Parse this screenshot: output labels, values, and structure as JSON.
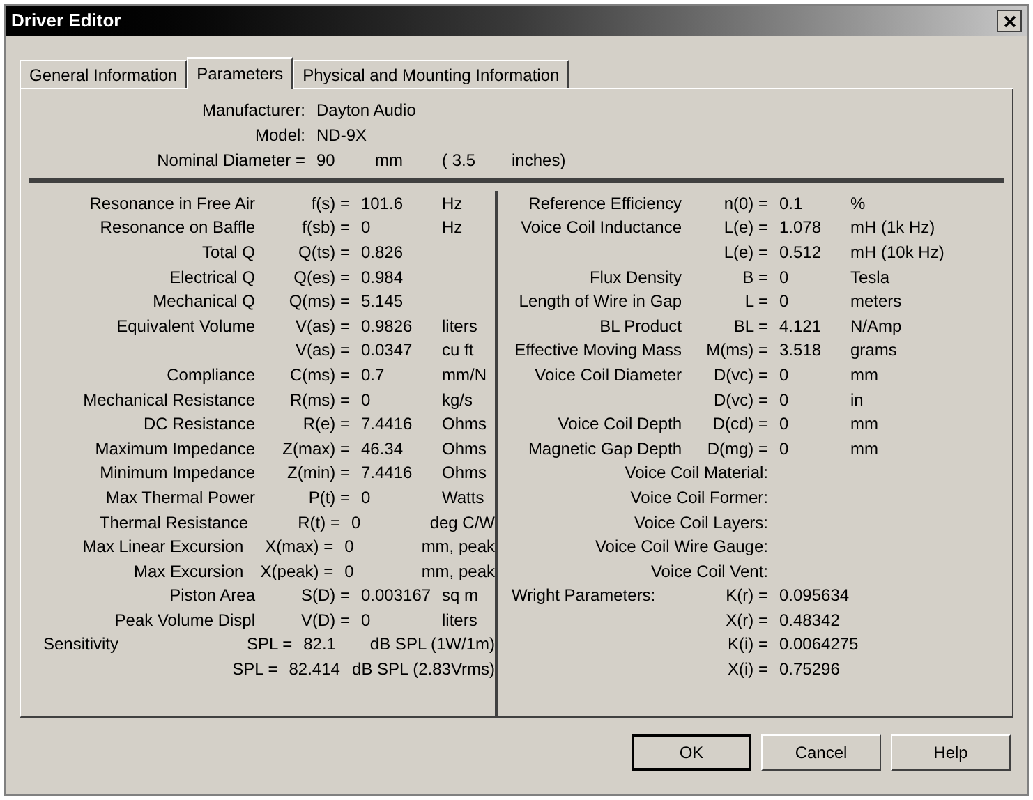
{
  "window": {
    "title": "Driver Editor"
  },
  "tabs": [
    {
      "label": "General Information",
      "selected": false
    },
    {
      "label": "Parameters",
      "selected": true
    },
    {
      "label": "Physical and Mounting Information",
      "selected": false
    }
  ],
  "header": [
    {
      "label": "Manufacturer:",
      "value": "Dayton Audio"
    },
    {
      "label": "Model:",
      "value": "ND-9X"
    }
  ],
  "nominal_diameter": {
    "label": "Nominal Diameter =",
    "value": "90",
    "unit": "mm",
    "alt_value": "( 3.5",
    "alt_unit": "inches)"
  },
  "left_params": [
    {
      "kind": "param",
      "label": "Resonance in Free Air",
      "symbol": "f(s) =",
      "value": "101.6",
      "unit": "Hz"
    },
    {
      "kind": "param",
      "label": "Resonance on Baffle",
      "symbol": "f(sb) =",
      "value": "0",
      "unit": "Hz"
    },
    {
      "kind": "param",
      "label": "Total Q",
      "symbol": "Q(ts) =",
      "value": "0.826"
    },
    {
      "kind": "param",
      "label": "Electrical Q",
      "symbol": "Q(es) =",
      "value": "0.984"
    },
    {
      "kind": "param",
      "label": "Mechanical Q",
      "symbol": "Q(ms) =",
      "value": "5.145"
    },
    {
      "kind": "param",
      "label": "Equivalent Volume",
      "symbol": "V(as) =",
      "value": "0.9826",
      "unit": "liters"
    },
    {
      "kind": "param",
      "symbol": "V(as) =",
      "value": "0.0347",
      "unit": "cu ft"
    },
    {
      "kind": "param",
      "label": "Compliance",
      "symbol": "C(ms) =",
      "value": "0.7",
      "unit": "mm/N"
    },
    {
      "kind": "param",
      "label": "Mechanical Resistance",
      "symbol": "R(ms) =",
      "value": "0",
      "unit": "kg/s"
    },
    {
      "kind": "param",
      "label": "DC Resistance",
      "symbol": "R(e) =",
      "value": "7.4416",
      "unit": "Ohms"
    },
    {
      "kind": "param",
      "label": "Maximum Impedance",
      "symbol": "Z(max) =",
      "value": "46.34",
      "unit": "Ohms"
    },
    {
      "kind": "param",
      "label": "Minimum Impedance",
      "symbol": "Z(min) =",
      "value": "7.4416",
      "unit": "Ohms"
    },
    {
      "kind": "param",
      "label": "Max Thermal Power",
      "symbol": "P(t) =",
      "value": "0",
      "unit": "Watts"
    },
    {
      "kind": "param",
      "label": "Thermal Resistance",
      "symbol": "R(t) =",
      "value": "0",
      "unit": "deg C/W"
    },
    {
      "kind": "param",
      "label": "Max Linear Excursion",
      "symbol": "X(max) =",
      "value": "0",
      "unit": "mm, peak"
    },
    {
      "kind": "param",
      "label": "Max Excursion",
      "symbol": "X(peak) =",
      "value": "0",
      "unit": "mm, peak"
    },
    {
      "kind": "param",
      "label": "Piston Area",
      "symbol": "S(D) =",
      "value": "0.003167",
      "unit": "sq m"
    },
    {
      "kind": "param",
      "label": "Peak Volume Displ",
      "symbol": "V(D) =",
      "value": "0",
      "unit": "liters"
    },
    {
      "kind": "group",
      "label": "Sensitivity",
      "symbol": "SPL =",
      "value": "82.1",
      "unit": "dB SPL (1W/1m)"
    },
    {
      "kind": "group",
      "symbol": "SPL =",
      "value": "82.414",
      "unit": "dB SPL (2.83Vrms)"
    }
  ],
  "right_params": [
    {
      "kind": "param",
      "label": "Reference Efficiency",
      "symbol": "n(0) =",
      "value": "0.1",
      "unit": "%"
    },
    {
      "kind": "param",
      "label": "Voice Coil Inductance",
      "symbol": "L(e) =",
      "value": "1.078",
      "unit": "mH (1k Hz)"
    },
    {
      "kind": "param",
      "symbol": "L(e) =",
      "value": "0.512",
      "unit": "mH (10k Hz)"
    },
    {
      "kind": "param",
      "label": "Flux Density",
      "symbol": "B =",
      "value": "0",
      "unit": "Tesla"
    },
    {
      "kind": "param",
      "label": "Length of Wire in Gap",
      "symbol": "L =",
      "value": "0",
      "unit": "meters"
    },
    {
      "kind": "param",
      "label": "BL Product",
      "symbol": "BL =",
      "value": "4.121",
      "unit": "N/Amp"
    },
    {
      "kind": "param",
      "label": "Effective Moving Mass",
      "symbol": "M(ms) =",
      "value": "3.518",
      "unit": "grams"
    },
    {
      "kind": "param",
      "label": "Voice Coil Diameter",
      "symbol": "D(vc) =",
      "value": "0",
      "unit": "mm"
    },
    {
      "kind": "param",
      "symbol": "D(vc) =",
      "value": "0",
      "unit": "in"
    },
    {
      "kind": "param",
      "label": "Voice Coil Depth",
      "symbol": "D(cd) =",
      "value": "0",
      "unit": "mm"
    },
    {
      "kind": "param",
      "label": "Magnetic Gap Depth",
      "symbol": "D(mg) =",
      "value": "0",
      "unit": "mm"
    },
    {
      "kind": "field",
      "label": "Voice Coil Material:"
    },
    {
      "kind": "field",
      "label": "Voice Coil Former:"
    },
    {
      "kind": "field",
      "label": "Voice Coil Layers:"
    },
    {
      "kind": "field",
      "label": "Voice Coil Wire Gauge:"
    },
    {
      "kind": "field",
      "label": "Voice Coil Vent:"
    },
    {
      "kind": "group",
      "label": "Wright Parameters:",
      "symbol": "K(r) =",
      "value": "0.095634"
    },
    {
      "kind": "param",
      "symbol": "X(r) =",
      "value": "0.48342"
    },
    {
      "kind": "param",
      "symbol": "K(i) =",
      "value": "0.0064275"
    },
    {
      "kind": "param",
      "symbol": "X(i) =",
      "value": "0.75296"
    }
  ],
  "buttons": [
    {
      "label": "OK",
      "default": true
    },
    {
      "label": "Cancel",
      "default": false
    },
    {
      "label": "Help",
      "default": false
    }
  ]
}
